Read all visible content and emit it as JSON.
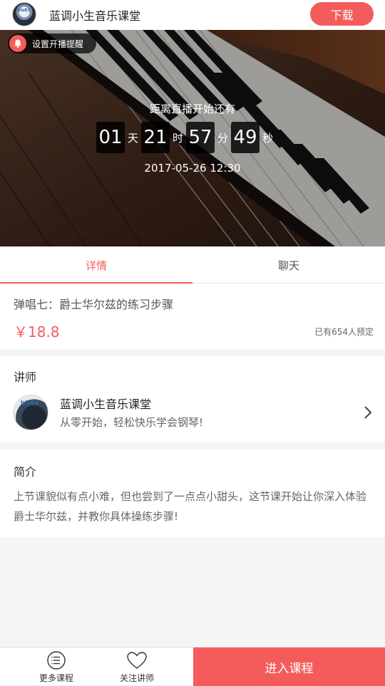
{
  "header": {
    "title": "蓝调小生音乐课堂",
    "download_label": "下载",
    "avatar_text": "bluES"
  },
  "banner": {
    "reminder_label": "设置开播提醒",
    "caption": "距离直播开始还有",
    "countdown": [
      {
        "value": "01",
        "unit": "天"
      },
      {
        "value": "21",
        "unit": "时"
      },
      {
        "value": "57",
        "unit": "分"
      },
      {
        "value": "49",
        "unit": "秒"
      }
    ],
    "start_time": "2017-05-26 12:30"
  },
  "tabs": [
    {
      "label": "详情",
      "active": true
    },
    {
      "label": "聊天",
      "active": false
    }
  ],
  "course": {
    "name": "弹唱七：爵士华尔兹的练习步骤",
    "price": "￥18.8",
    "booked": "已有654人预定"
  },
  "teacher": {
    "section_title": "讲师",
    "name": "蓝调小生音乐课堂",
    "description": "从零开始，轻松快乐学会钢琴!",
    "avatar_text": "bluES"
  },
  "intro": {
    "section_title": "简介",
    "text": "上节课貌似有点小难，但也尝到了一点点小甜头，这节课开始让你深入体验爵士华尔兹，并教你具体操练步骤!"
  },
  "bottom_bar": {
    "more_courses": "更多课程",
    "follow_teacher": "关注讲师",
    "enter_course": "进入课程"
  },
  "colors": {
    "accent": "#f45c5c",
    "background": "#f5f5f5"
  },
  "icons": {
    "reminder": "bell-icon",
    "teacher_link": "chevron-right-icon",
    "more_courses": "list-icon",
    "follow_teacher": "heart-icon"
  }
}
